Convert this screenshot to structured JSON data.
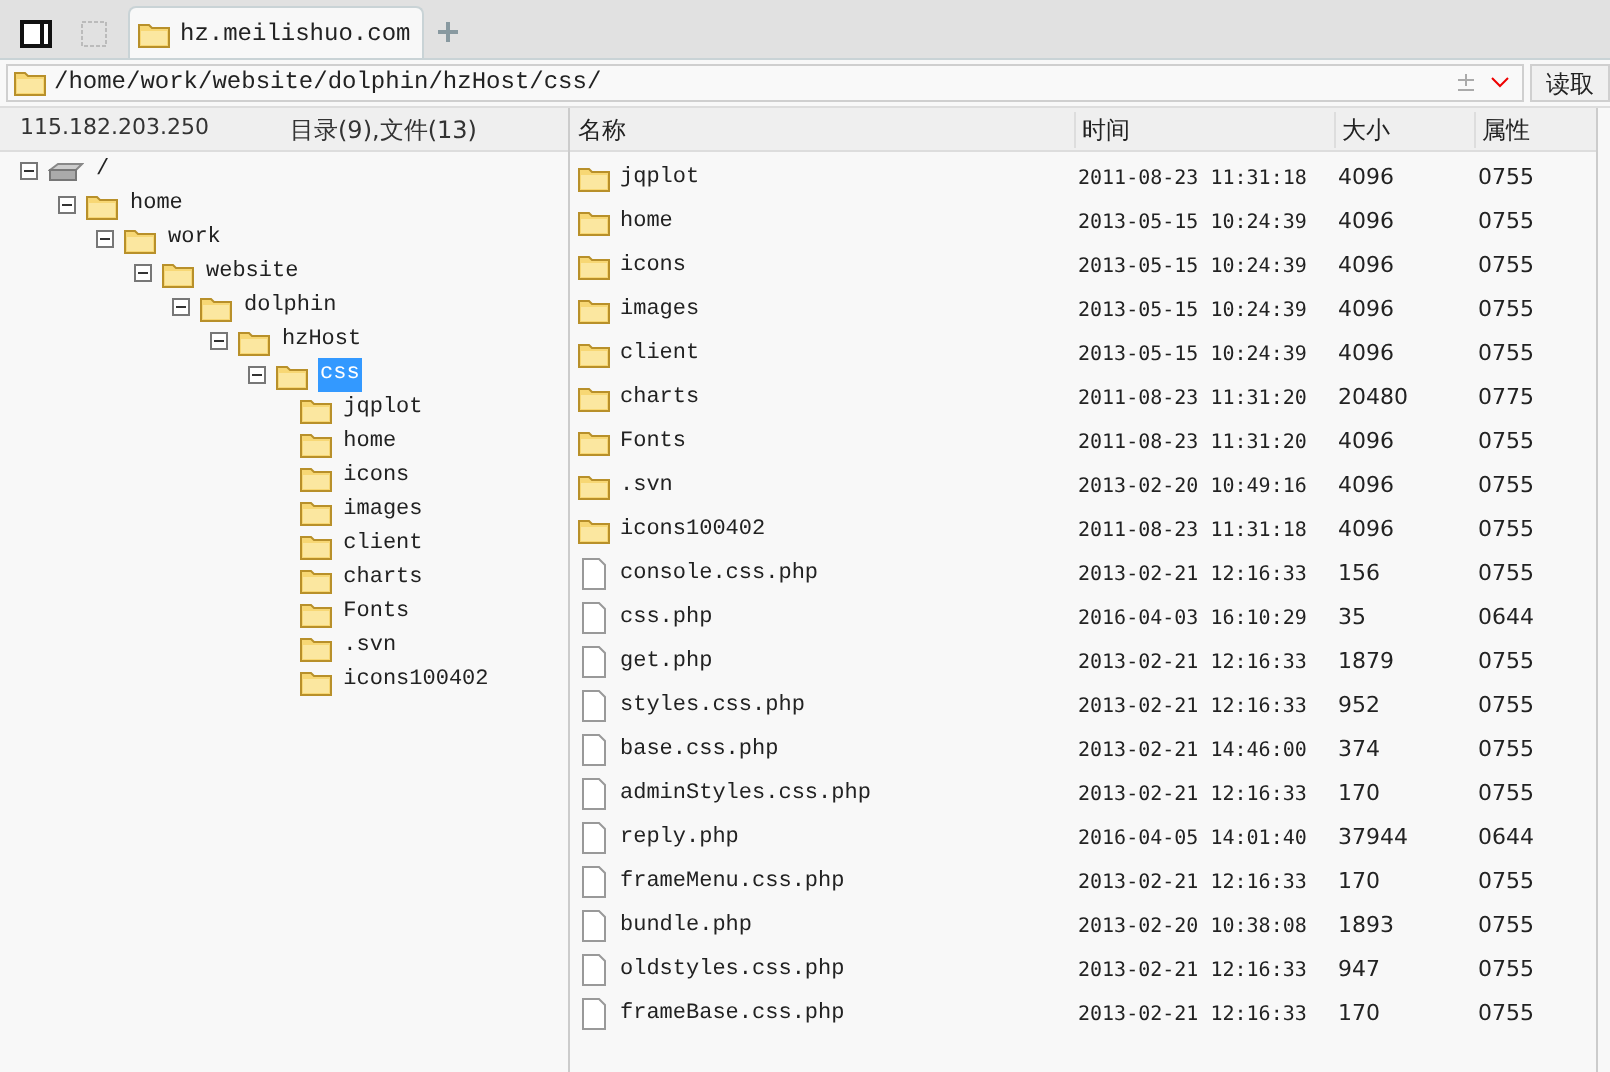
{
  "tabs": [
    {
      "kind": "panel",
      "selected": false
    },
    {
      "kind": "blank",
      "selected": false
    },
    {
      "kind": "site",
      "label": "hz.meilishuo.com",
      "selected": true
    }
  ],
  "address": {
    "value": "/home/work/website/dolphin/hzHost/css/",
    "read_button": "读取"
  },
  "status": {
    "host": "115.182.203.250",
    "counts": "目录(9),文件(13)"
  },
  "columns": [
    "名称",
    "时间",
    "大小",
    "属性"
  ],
  "tree": [
    {
      "kind": "drive",
      "label": "/",
      "expanded": true,
      "selected": false,
      "children": [
        {
          "kind": "folder",
          "label": "home",
          "expanded": true,
          "selected": false,
          "children": [
            {
              "kind": "folder",
              "label": "work",
              "expanded": true,
              "selected": false,
              "children": [
                {
                  "kind": "folder",
                  "label": "website",
                  "expanded": true,
                  "selected": false,
                  "children": [
                    {
                      "kind": "folder",
                      "label": "dolphin",
                      "expanded": true,
                      "selected": false,
                      "children": [
                        {
                          "kind": "folder",
                          "label": "hzHost",
                          "expanded": true,
                          "selected": false,
                          "children": [
                            {
                              "kind": "folder",
                              "label": "css",
                              "expanded": true,
                              "selected": true,
                              "children": [
                                {
                                  "kind": "folder",
                                  "label": "jqplot",
                                  "selected": false
                                },
                                {
                                  "kind": "folder",
                                  "label": "home",
                                  "selected": false
                                },
                                {
                                  "kind": "folder",
                                  "label": "icons",
                                  "selected": false
                                },
                                {
                                  "kind": "folder",
                                  "label": "images",
                                  "selected": false
                                },
                                {
                                  "kind": "folder",
                                  "label": "client",
                                  "selected": false
                                },
                                {
                                  "kind": "folder",
                                  "label": "charts",
                                  "selected": false
                                },
                                {
                                  "kind": "folder",
                                  "label": "Fonts",
                                  "selected": false
                                },
                                {
                                  "kind": "folder",
                                  "label": ".svn",
                                  "selected": false
                                },
                                {
                                  "kind": "folder",
                                  "label": "icons100402",
                                  "selected": false
                                }
                              ]
                            }
                          ]
                        }
                      ]
                    }
                  ]
                }
              ]
            }
          ]
        }
      ]
    }
  ],
  "files": [
    {
      "kind": "folder",
      "name": "jqplot",
      "time": "2011-08-23 11:31:18",
      "size": "4096",
      "mode": "0755"
    },
    {
      "kind": "folder",
      "name": "home",
      "time": "2013-05-15 10:24:39",
      "size": "4096",
      "mode": "0755"
    },
    {
      "kind": "folder",
      "name": "icons",
      "time": "2013-05-15 10:24:39",
      "size": "4096",
      "mode": "0755"
    },
    {
      "kind": "folder",
      "name": "images",
      "time": "2013-05-15 10:24:39",
      "size": "4096",
      "mode": "0755"
    },
    {
      "kind": "folder",
      "name": "client",
      "time": "2013-05-15 10:24:39",
      "size": "4096",
      "mode": "0755"
    },
    {
      "kind": "folder",
      "name": "charts",
      "time": "2011-08-23 11:31:20",
      "size": "20480",
      "mode": "0775"
    },
    {
      "kind": "folder",
      "name": "Fonts",
      "time": "2011-08-23 11:31:20",
      "size": "4096",
      "mode": "0755"
    },
    {
      "kind": "folder",
      "name": ".svn",
      "time": "2013-02-20 10:49:16",
      "size": "4096",
      "mode": "0755"
    },
    {
      "kind": "folder",
      "name": "icons100402",
      "time": "2011-08-23 11:31:18",
      "size": "4096",
      "mode": "0755"
    },
    {
      "kind": "file",
      "name": "console.css.php",
      "time": "2013-02-21 12:16:33",
      "size": "156",
      "mode": "0755"
    },
    {
      "kind": "file",
      "name": "css.php",
      "time": "2016-04-03 16:10:29",
      "size": "35",
      "mode": "0644"
    },
    {
      "kind": "file",
      "name": "get.php",
      "time": "2013-02-21 12:16:33",
      "size": "1879",
      "mode": "0755"
    },
    {
      "kind": "file",
      "name": "styles.css.php",
      "time": "2013-02-21 12:16:33",
      "size": "952",
      "mode": "0755"
    },
    {
      "kind": "file",
      "name": "base.css.php",
      "time": "2013-02-21 14:46:00",
      "size": "374",
      "mode": "0755"
    },
    {
      "kind": "file",
      "name": "adminStyles.css.php",
      "time": "2013-02-21 12:16:33",
      "size": "170",
      "mode": "0755"
    },
    {
      "kind": "file",
      "name": "reply.php",
      "time": "2016-04-05 14:01:40",
      "size": "37944",
      "mode": "0644"
    },
    {
      "kind": "file",
      "name": "frameMenu.css.php",
      "time": "2013-02-21 12:16:33",
      "size": "170",
      "mode": "0755"
    },
    {
      "kind": "file",
      "name": "bundle.php",
      "time": "2013-02-20 10:38:08",
      "size": "1893",
      "mode": "0755"
    },
    {
      "kind": "file",
      "name": "oldstyles.css.php",
      "time": "2013-02-21 12:16:33",
      "size": "947",
      "mode": "0755"
    },
    {
      "kind": "file",
      "name": "frameBase.css.php",
      "time": "2013-02-21 12:16:33",
      "size": "170",
      "mode": "0755"
    }
  ]
}
